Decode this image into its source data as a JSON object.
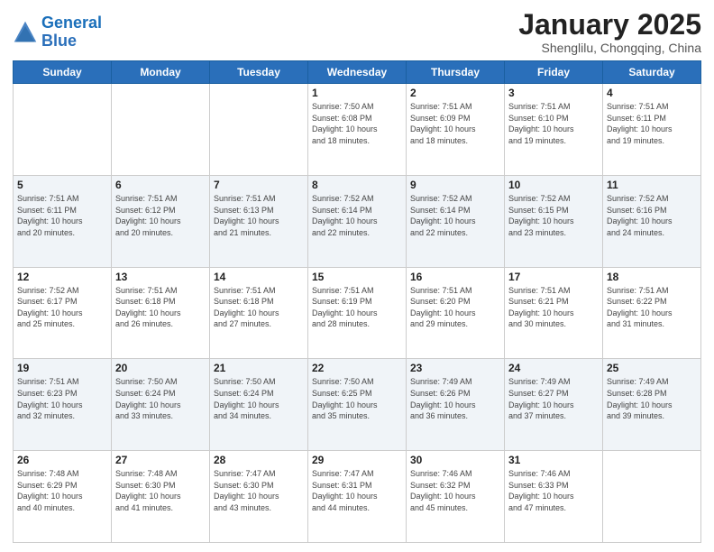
{
  "header": {
    "logo_line1": "General",
    "logo_line2": "Blue",
    "month_title": "January 2025",
    "location": "Shenglilu, Chongqing, China"
  },
  "weekdays": [
    "Sunday",
    "Monday",
    "Tuesday",
    "Wednesday",
    "Thursday",
    "Friday",
    "Saturday"
  ],
  "weeks": [
    [
      {
        "day": "",
        "detail": ""
      },
      {
        "day": "",
        "detail": ""
      },
      {
        "day": "",
        "detail": ""
      },
      {
        "day": "1",
        "detail": "Sunrise: 7:50 AM\nSunset: 6:08 PM\nDaylight: 10 hours\nand 18 minutes."
      },
      {
        "day": "2",
        "detail": "Sunrise: 7:51 AM\nSunset: 6:09 PM\nDaylight: 10 hours\nand 18 minutes."
      },
      {
        "day": "3",
        "detail": "Sunrise: 7:51 AM\nSunset: 6:10 PM\nDaylight: 10 hours\nand 19 minutes."
      },
      {
        "day": "4",
        "detail": "Sunrise: 7:51 AM\nSunset: 6:11 PM\nDaylight: 10 hours\nand 19 minutes."
      }
    ],
    [
      {
        "day": "5",
        "detail": "Sunrise: 7:51 AM\nSunset: 6:11 PM\nDaylight: 10 hours\nand 20 minutes."
      },
      {
        "day": "6",
        "detail": "Sunrise: 7:51 AM\nSunset: 6:12 PM\nDaylight: 10 hours\nand 20 minutes."
      },
      {
        "day": "7",
        "detail": "Sunrise: 7:51 AM\nSunset: 6:13 PM\nDaylight: 10 hours\nand 21 minutes."
      },
      {
        "day": "8",
        "detail": "Sunrise: 7:52 AM\nSunset: 6:14 PM\nDaylight: 10 hours\nand 22 minutes."
      },
      {
        "day": "9",
        "detail": "Sunrise: 7:52 AM\nSunset: 6:14 PM\nDaylight: 10 hours\nand 22 minutes."
      },
      {
        "day": "10",
        "detail": "Sunrise: 7:52 AM\nSunset: 6:15 PM\nDaylight: 10 hours\nand 23 minutes."
      },
      {
        "day": "11",
        "detail": "Sunrise: 7:52 AM\nSunset: 6:16 PM\nDaylight: 10 hours\nand 24 minutes."
      }
    ],
    [
      {
        "day": "12",
        "detail": "Sunrise: 7:52 AM\nSunset: 6:17 PM\nDaylight: 10 hours\nand 25 minutes."
      },
      {
        "day": "13",
        "detail": "Sunrise: 7:51 AM\nSunset: 6:18 PM\nDaylight: 10 hours\nand 26 minutes."
      },
      {
        "day": "14",
        "detail": "Sunrise: 7:51 AM\nSunset: 6:18 PM\nDaylight: 10 hours\nand 27 minutes."
      },
      {
        "day": "15",
        "detail": "Sunrise: 7:51 AM\nSunset: 6:19 PM\nDaylight: 10 hours\nand 28 minutes."
      },
      {
        "day": "16",
        "detail": "Sunrise: 7:51 AM\nSunset: 6:20 PM\nDaylight: 10 hours\nand 29 minutes."
      },
      {
        "day": "17",
        "detail": "Sunrise: 7:51 AM\nSunset: 6:21 PM\nDaylight: 10 hours\nand 30 minutes."
      },
      {
        "day": "18",
        "detail": "Sunrise: 7:51 AM\nSunset: 6:22 PM\nDaylight: 10 hours\nand 31 minutes."
      }
    ],
    [
      {
        "day": "19",
        "detail": "Sunrise: 7:51 AM\nSunset: 6:23 PM\nDaylight: 10 hours\nand 32 minutes."
      },
      {
        "day": "20",
        "detail": "Sunrise: 7:50 AM\nSunset: 6:24 PM\nDaylight: 10 hours\nand 33 minutes."
      },
      {
        "day": "21",
        "detail": "Sunrise: 7:50 AM\nSunset: 6:24 PM\nDaylight: 10 hours\nand 34 minutes."
      },
      {
        "day": "22",
        "detail": "Sunrise: 7:50 AM\nSunset: 6:25 PM\nDaylight: 10 hours\nand 35 minutes."
      },
      {
        "day": "23",
        "detail": "Sunrise: 7:49 AM\nSunset: 6:26 PM\nDaylight: 10 hours\nand 36 minutes."
      },
      {
        "day": "24",
        "detail": "Sunrise: 7:49 AM\nSunset: 6:27 PM\nDaylight: 10 hours\nand 37 minutes."
      },
      {
        "day": "25",
        "detail": "Sunrise: 7:49 AM\nSunset: 6:28 PM\nDaylight: 10 hours\nand 39 minutes."
      }
    ],
    [
      {
        "day": "26",
        "detail": "Sunrise: 7:48 AM\nSunset: 6:29 PM\nDaylight: 10 hours\nand 40 minutes."
      },
      {
        "day": "27",
        "detail": "Sunrise: 7:48 AM\nSunset: 6:30 PM\nDaylight: 10 hours\nand 41 minutes."
      },
      {
        "day": "28",
        "detail": "Sunrise: 7:47 AM\nSunset: 6:30 PM\nDaylight: 10 hours\nand 43 minutes."
      },
      {
        "day": "29",
        "detail": "Sunrise: 7:47 AM\nSunset: 6:31 PM\nDaylight: 10 hours\nand 44 minutes."
      },
      {
        "day": "30",
        "detail": "Sunrise: 7:46 AM\nSunset: 6:32 PM\nDaylight: 10 hours\nand 45 minutes."
      },
      {
        "day": "31",
        "detail": "Sunrise: 7:46 AM\nSunset: 6:33 PM\nDaylight: 10 hours\nand 47 minutes."
      },
      {
        "day": "",
        "detail": ""
      }
    ]
  ]
}
